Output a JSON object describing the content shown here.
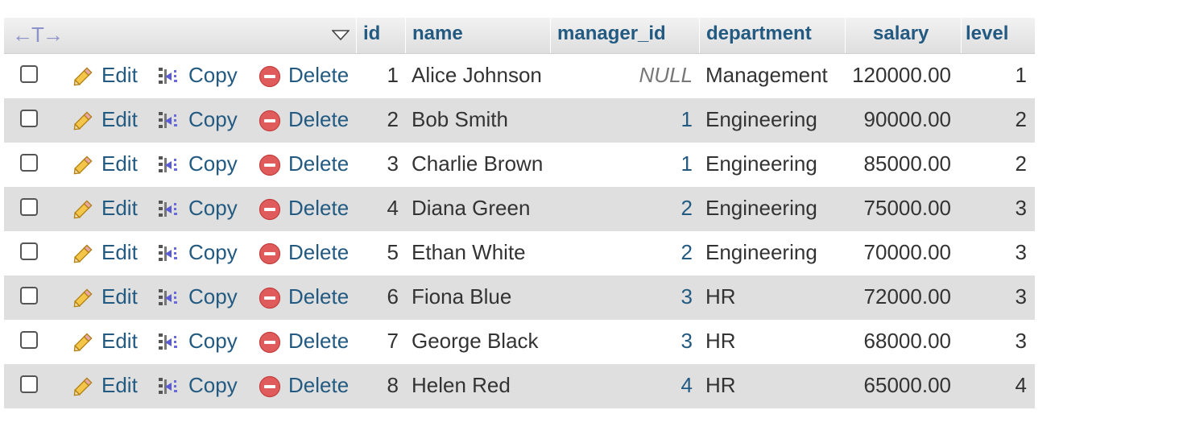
{
  "header": {
    "sort_arrows": "←T→",
    "columns": {
      "id": "id",
      "name": "name",
      "manager_id": "manager_id",
      "department": "department",
      "salary": "salary",
      "level": "level"
    }
  },
  "actions": {
    "edit": "Edit",
    "copy": "Copy",
    "delete": "Delete"
  },
  "rows": [
    {
      "id": "1",
      "name": "Alice Johnson",
      "manager_id": "NULL",
      "department": "Management",
      "salary": "120000.00",
      "level": "1"
    },
    {
      "id": "2",
      "name": "Bob Smith",
      "manager_id": "1",
      "department": "Engineering",
      "salary": "90000.00",
      "level": "2"
    },
    {
      "id": "3",
      "name": "Charlie Brown",
      "manager_id": "1",
      "department": "Engineering",
      "salary": "85000.00",
      "level": "2"
    },
    {
      "id": "4",
      "name": "Diana Green",
      "manager_id": "2",
      "department": "Engineering",
      "salary": "75000.00",
      "level": "3"
    },
    {
      "id": "5",
      "name": "Ethan White",
      "manager_id": "2",
      "department": "Engineering",
      "salary": "70000.00",
      "level": "3"
    },
    {
      "id": "6",
      "name": "Fiona Blue",
      "manager_id": "3",
      "department": "HR",
      "salary": "72000.00",
      "level": "3"
    },
    {
      "id": "7",
      "name": "George Black",
      "manager_id": "3",
      "department": "HR",
      "salary": "68000.00",
      "level": "3"
    },
    {
      "id": "8",
      "name": "Helen Red",
      "manager_id": "4",
      "department": "HR",
      "salary": "65000.00",
      "level": "4"
    }
  ],
  "icons": {
    "edit": "pencil-icon",
    "copy": "copy-icon",
    "delete": "delete-icon",
    "sort": "sort-triangle-icon"
  },
  "colors": {
    "link": "#235a81",
    "alt_row": "#dfdfdf",
    "null_text": "#777777"
  }
}
